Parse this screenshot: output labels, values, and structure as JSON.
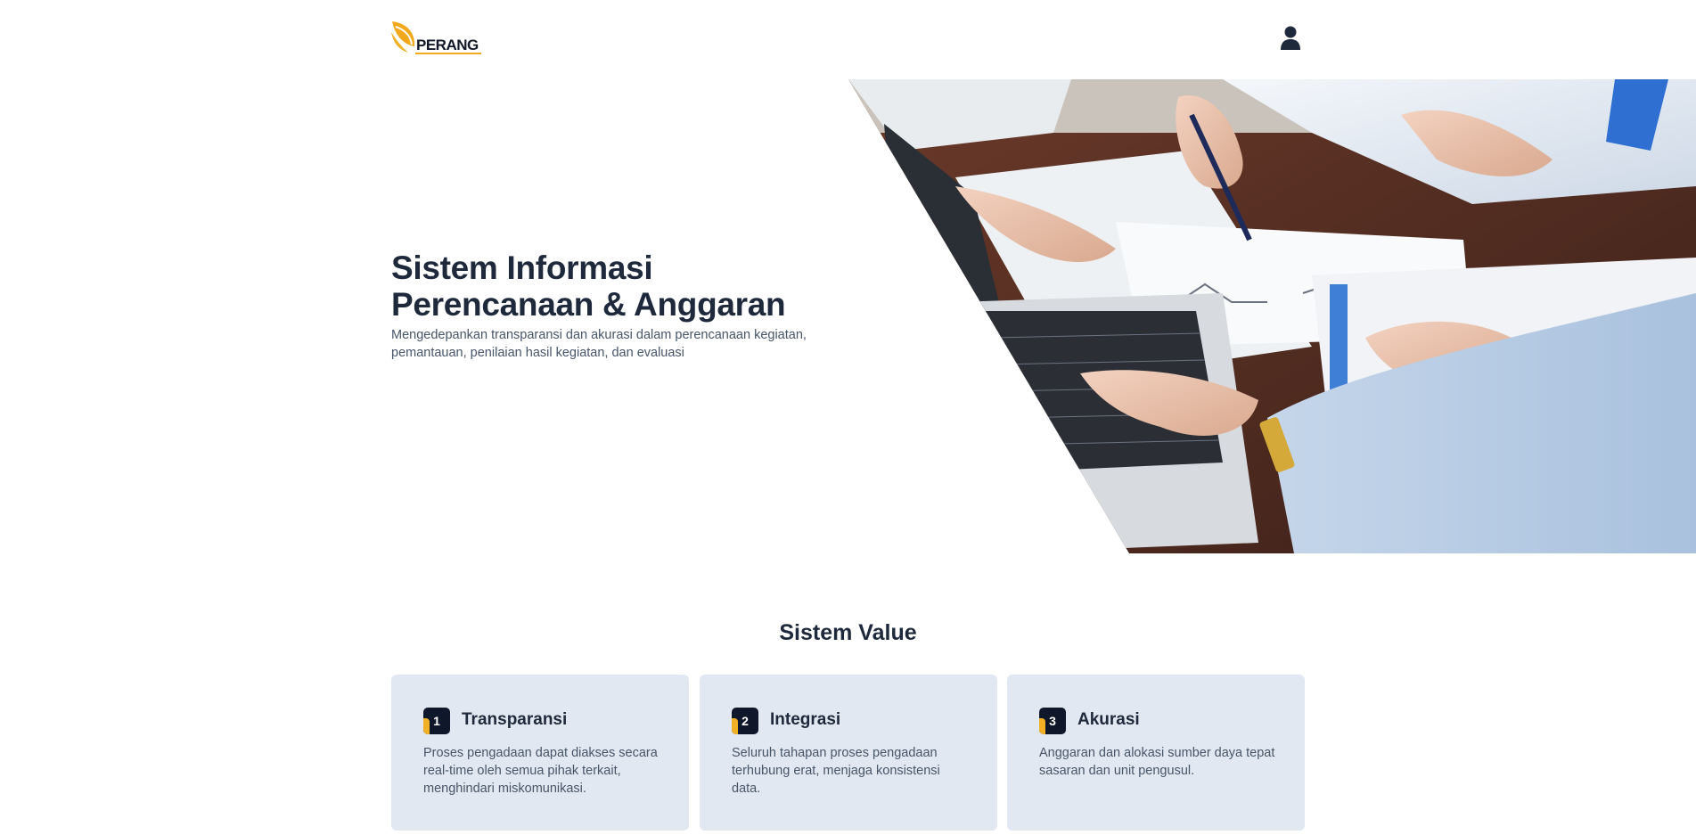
{
  "header": {
    "logo_text": "PERANG",
    "user_icon": "user-icon"
  },
  "hero": {
    "title_line1": "Sistem Informasi",
    "title_line2": "Perencanaan & Anggaran",
    "subtitle": "Mengedepankan transparansi dan akurasi dalam perencanaan kegiatan, pemantauan, penilaian hasil kegiatan, dan evaluasi",
    "image": "business-meeting-photo"
  },
  "values": {
    "title": "Sistem Value",
    "cards": [
      {
        "number": "1",
        "title": "Transparansi",
        "description": "Proses pengadaan dapat diakses secara real-time oleh semua pihak terkait, menghindari miskomunikasi."
      },
      {
        "number": "2",
        "title": "Integrasi",
        "description": "Seluruh tahapan proses pengadaan terhubung erat, menjaga konsistensi data."
      },
      {
        "number": "3",
        "title": "Akurasi",
        "description": "Anggaran dan alokasi sumber daya tepat sasaran dan unit pengusul."
      }
    ]
  },
  "colors": {
    "accent": "#f2a81d",
    "dark": "#0f172a",
    "card_bg": "#e2e8f1"
  }
}
